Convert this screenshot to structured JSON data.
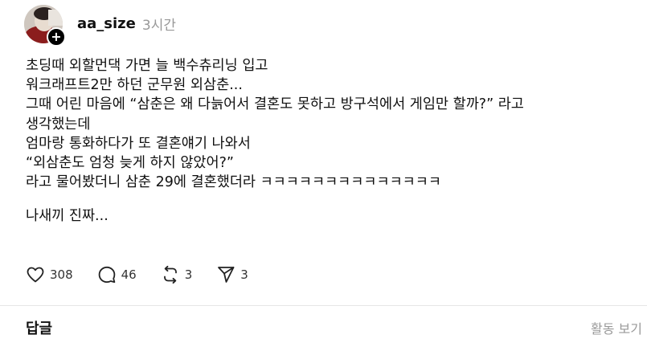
{
  "post": {
    "username": "aa_size",
    "time": "3시간",
    "follow_symbol": "+",
    "lines": [
      "초딩때 외할먼댁 가면 늘 백수츄리닝 입고",
      "워크래프트2만 하던 군무원 외삼춘...",
      "그때 어린 마음에 “삼춘은 왜 다늙어서 결혼도 못하고 방구석에서 게임만 할까?” 라고",
      "생각했는데",
      "엄마랑 통화하다가 또 결혼얘기 나와서",
      "“외삼춘도 엄청 늦게 하지 않았어?”",
      "라고 물어봤더니 삼춘 29에 결혼했더라 ㅋㅋㅋㅋㅋㅋㅋㅋㅋㅋㅋㅋㅋㅋ"
    ],
    "closing_line": "나새끼 진짜..."
  },
  "actions": {
    "like": {
      "icon": "heart-icon",
      "count": "308"
    },
    "comment": {
      "icon": "comment-icon",
      "count": "46"
    },
    "repost": {
      "icon": "repost-icon",
      "count": "3"
    },
    "share": {
      "icon": "send-icon",
      "count": "3"
    }
  },
  "footer": {
    "replies_label": "답글",
    "activity_label": "활동 보기"
  }
}
